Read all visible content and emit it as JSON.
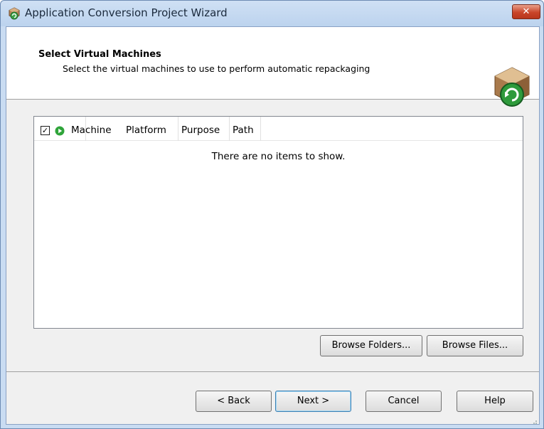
{
  "window": {
    "title": "Application Conversion Project Wizard",
    "close_label": "✕"
  },
  "header": {
    "title": "Select Virtual Machines",
    "subtitle": "Select the virtual machines to use to perform automatic repackaging"
  },
  "list": {
    "check_glyph": "✓",
    "columns": [
      "Machine",
      "Platform",
      "Purpose",
      "Path"
    ],
    "empty_message": "There are no items to show."
  },
  "buttons": {
    "browse_folders": "Browse Folders...",
    "browse_files": "Browse Files...",
    "back": "< Back",
    "next": "Next >",
    "cancel": "Cancel",
    "help": "Help"
  },
  "colors": {
    "titlebar": "#bcd3ee",
    "close": "#c9452a",
    "play_icon": "#2fa43a"
  }
}
